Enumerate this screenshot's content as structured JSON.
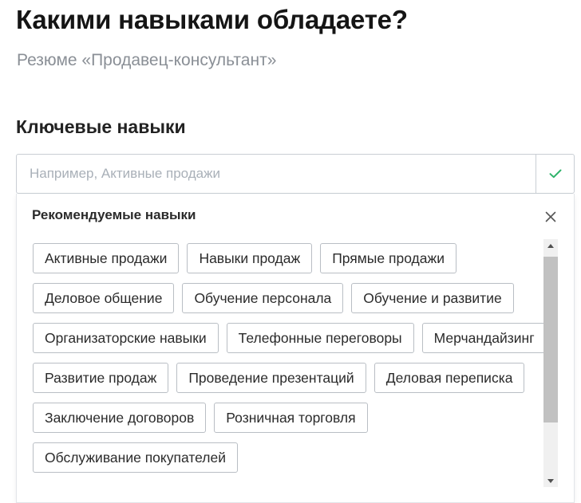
{
  "page": {
    "title": "Какими навыками обладаете?",
    "subtitle": "Резюме «Продавец-консультант»",
    "section_title": "Ключевые навыки"
  },
  "skill_input": {
    "value": "",
    "placeholder": "Например, Активные продажи"
  },
  "recommended": {
    "title": "Рекомендуемые навыки",
    "chips": [
      "Активные продажи",
      "Навыки продаж",
      "Прямые продажи",
      "Деловое общение",
      "Обучение персонала",
      "Обучение и развитие",
      "Организаторские навыки",
      "Телефонные переговоры",
      "Мерчандайзинг",
      "Развитие продаж",
      "Проведение презентаций",
      "Деловая переписка",
      "Заключение договоров",
      "Розничная торговля",
      "Обслуживание покупателей"
    ]
  },
  "icons": {
    "confirm": "check-icon",
    "close": "close-icon",
    "scroll_up": "triangle-up-icon",
    "scroll_down": "triangle-down-icon"
  },
  "colors": {
    "confirm_check": "#2fb36b",
    "chip_border": "#b9bec4",
    "input_border": "#c9ced4",
    "placeholder": "#a9b0b8",
    "subtitle": "#8a8f96"
  }
}
